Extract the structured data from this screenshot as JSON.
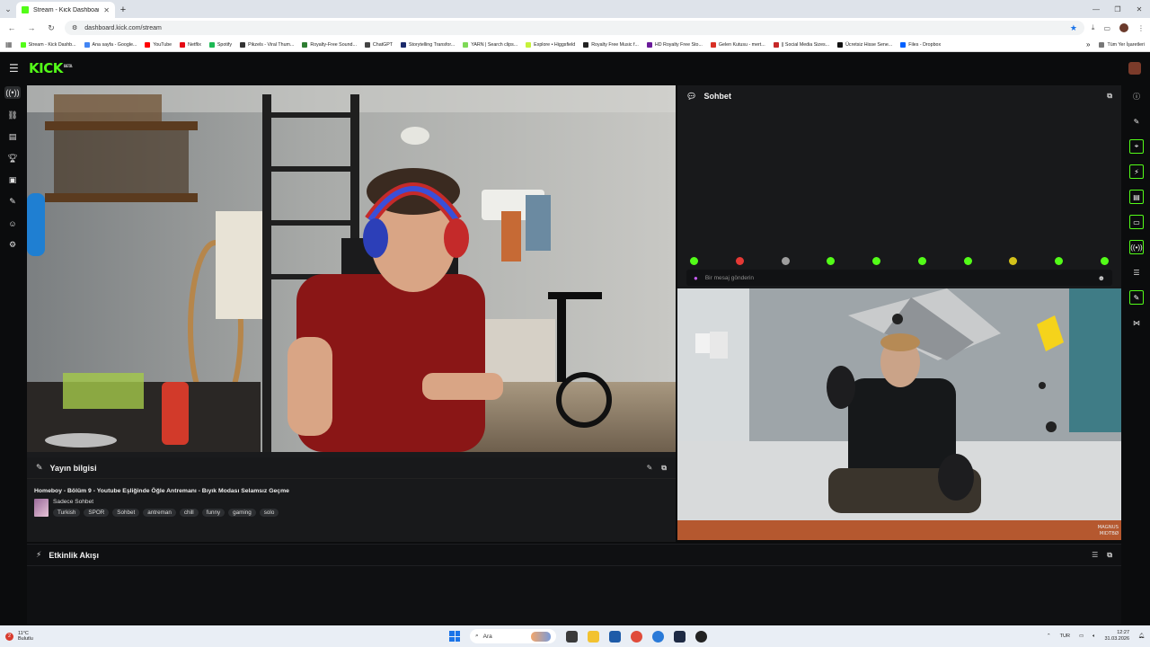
{
  "browser": {
    "tab_title": "Stream - Kick Dashboard",
    "url": "dashboard.kick.com/stream",
    "bookmarks": [
      {
        "label": "Stream - Kick Dashb...",
        "color": "#53fc18"
      },
      {
        "label": "Ana sayfa - Google...",
        "color": "#4285f4"
      },
      {
        "label": "YouTube",
        "color": "#ff0000"
      },
      {
        "label": "Netflix",
        "color": "#e50914"
      },
      {
        "label": "Spotify",
        "color": "#1db954"
      },
      {
        "label": "Pikzels - Viral Thum...",
        "color": "#333333"
      },
      {
        "label": "Royalty-Free Sound...",
        "color": "#2e7d32"
      },
      {
        "label": "ChatGPT",
        "color": "#444444"
      },
      {
        "label": "Storytelling Transfor...",
        "color": "#1b2a6b"
      },
      {
        "label": "YARN | Search clips...",
        "color": "#7ed957"
      },
      {
        "label": "Explore • Higgsfield",
        "color": "#c6f23a"
      },
      {
        "label": "Royalty Free Music f...",
        "color": "#222222"
      },
      {
        "label": "HD Royalty Free Sto...",
        "color": "#6a1b9a"
      },
      {
        "label": "Gelen Kutusu - mert...",
        "color": "#d93025"
      },
      {
        "label": "|| Social Media Sizes...",
        "color": "#c62828"
      },
      {
        "label": "Ücretsiz Hisse Sene...",
        "color": "#111111"
      },
      {
        "label": "Files - Dropbox",
        "color": "#0061ff"
      }
    ],
    "bookmarks_overflow": "»",
    "all_bookmarks": "Tüm Yer İşaretleri"
  },
  "kick": {
    "logo": "KICK",
    "logo_beta": "BETA"
  },
  "chat": {
    "title": "Sohbet",
    "input_placeholder": "Bir mesaj gönderin",
    "emote_colors": [
      "#53fc18",
      "#e53935",
      "#9e9e9e",
      "#53fc18",
      "#53fc18",
      "#53fc18",
      "#53fc18",
      "#d4c21a",
      "#53fc18",
      "#53fc18"
    ]
  },
  "stream_info": {
    "title": "Yayın bilgisi",
    "stream_title": "Homeboy - Bölüm 9 - Youtube Eşliğinde Öğle Antremanı - Bıyık Modası Selamsız Geçme",
    "category": "Sadece Sohbet",
    "tags": [
      "Turkish",
      "SPOR",
      "Sohbet",
      "antreman",
      "chill",
      "funny",
      "gaming",
      "solo"
    ]
  },
  "activity": {
    "title": "Etkinlik Akışı"
  },
  "video_cam": {
    "credit_line1": "MAGNUS",
    "credit_line2": "MIDTBØ"
  },
  "taskbar": {
    "weather_badge": "2",
    "temp": "11°C",
    "condition": "Bulutlu",
    "search_label": "Ara",
    "lang": "TUR",
    "time": "12:27",
    "date": "31.03.2026"
  }
}
